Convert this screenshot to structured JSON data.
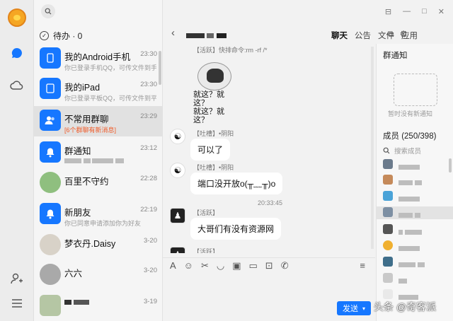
{
  "todo": {
    "label": "待办 · 0"
  },
  "conversations": [
    {
      "name": "我的Android手机",
      "time": "23:30",
      "sub": "你已登录手机QQ，可传文件到手机"
    },
    {
      "name": "我的iPad",
      "time": "23:30",
      "sub": "你已登录平板QQ，可传文件到平板"
    },
    {
      "name": "不常用群聊",
      "time": "23:29",
      "sub": "[6个群聊有新消息]"
    },
    {
      "name": "群通知",
      "time": "23:12",
      "sub": ""
    },
    {
      "name": "百里不守约",
      "time": "22:28",
      "sub": ""
    },
    {
      "name": "新朋友",
      "time": "22:19",
      "sub": "你已同意申请添加你为好友"
    },
    {
      "name": "梦衣丹.Daisy",
      "time": "3-20",
      "sub": ""
    },
    {
      "name": "六六",
      "time": "3-20",
      "sub": ""
    },
    {
      "name": "",
      "time": "3-19",
      "sub": ""
    }
  ],
  "chat": {
    "tabs": [
      "聊天",
      "公告",
      "文件",
      "应用"
    ],
    "messages": [
      {
        "who": "【活跃】快排命令:rm -rf /*",
        "caption": "就这？就这？\n就这？就这？"
      },
      {
        "who": "【吐槽】•阴阳",
        "text": "可以了"
      },
      {
        "who": "【吐槽】•阴阳",
        "text": "端口没开放o(╥﹏╥)o"
      },
      {
        "time": "20:33:45"
      },
      {
        "who": "【活跃】",
        "text": "大哥们有没有资源网"
      },
      {
        "who": "【活跃】"
      }
    ],
    "send_label": "发送"
  },
  "side": {
    "notice_title": "群通知",
    "notice_empty": "暂时没有新通知",
    "members_title": "成员 (250/398)",
    "member_search": "搜索成员"
  },
  "watermark": "头条 @奇客派"
}
